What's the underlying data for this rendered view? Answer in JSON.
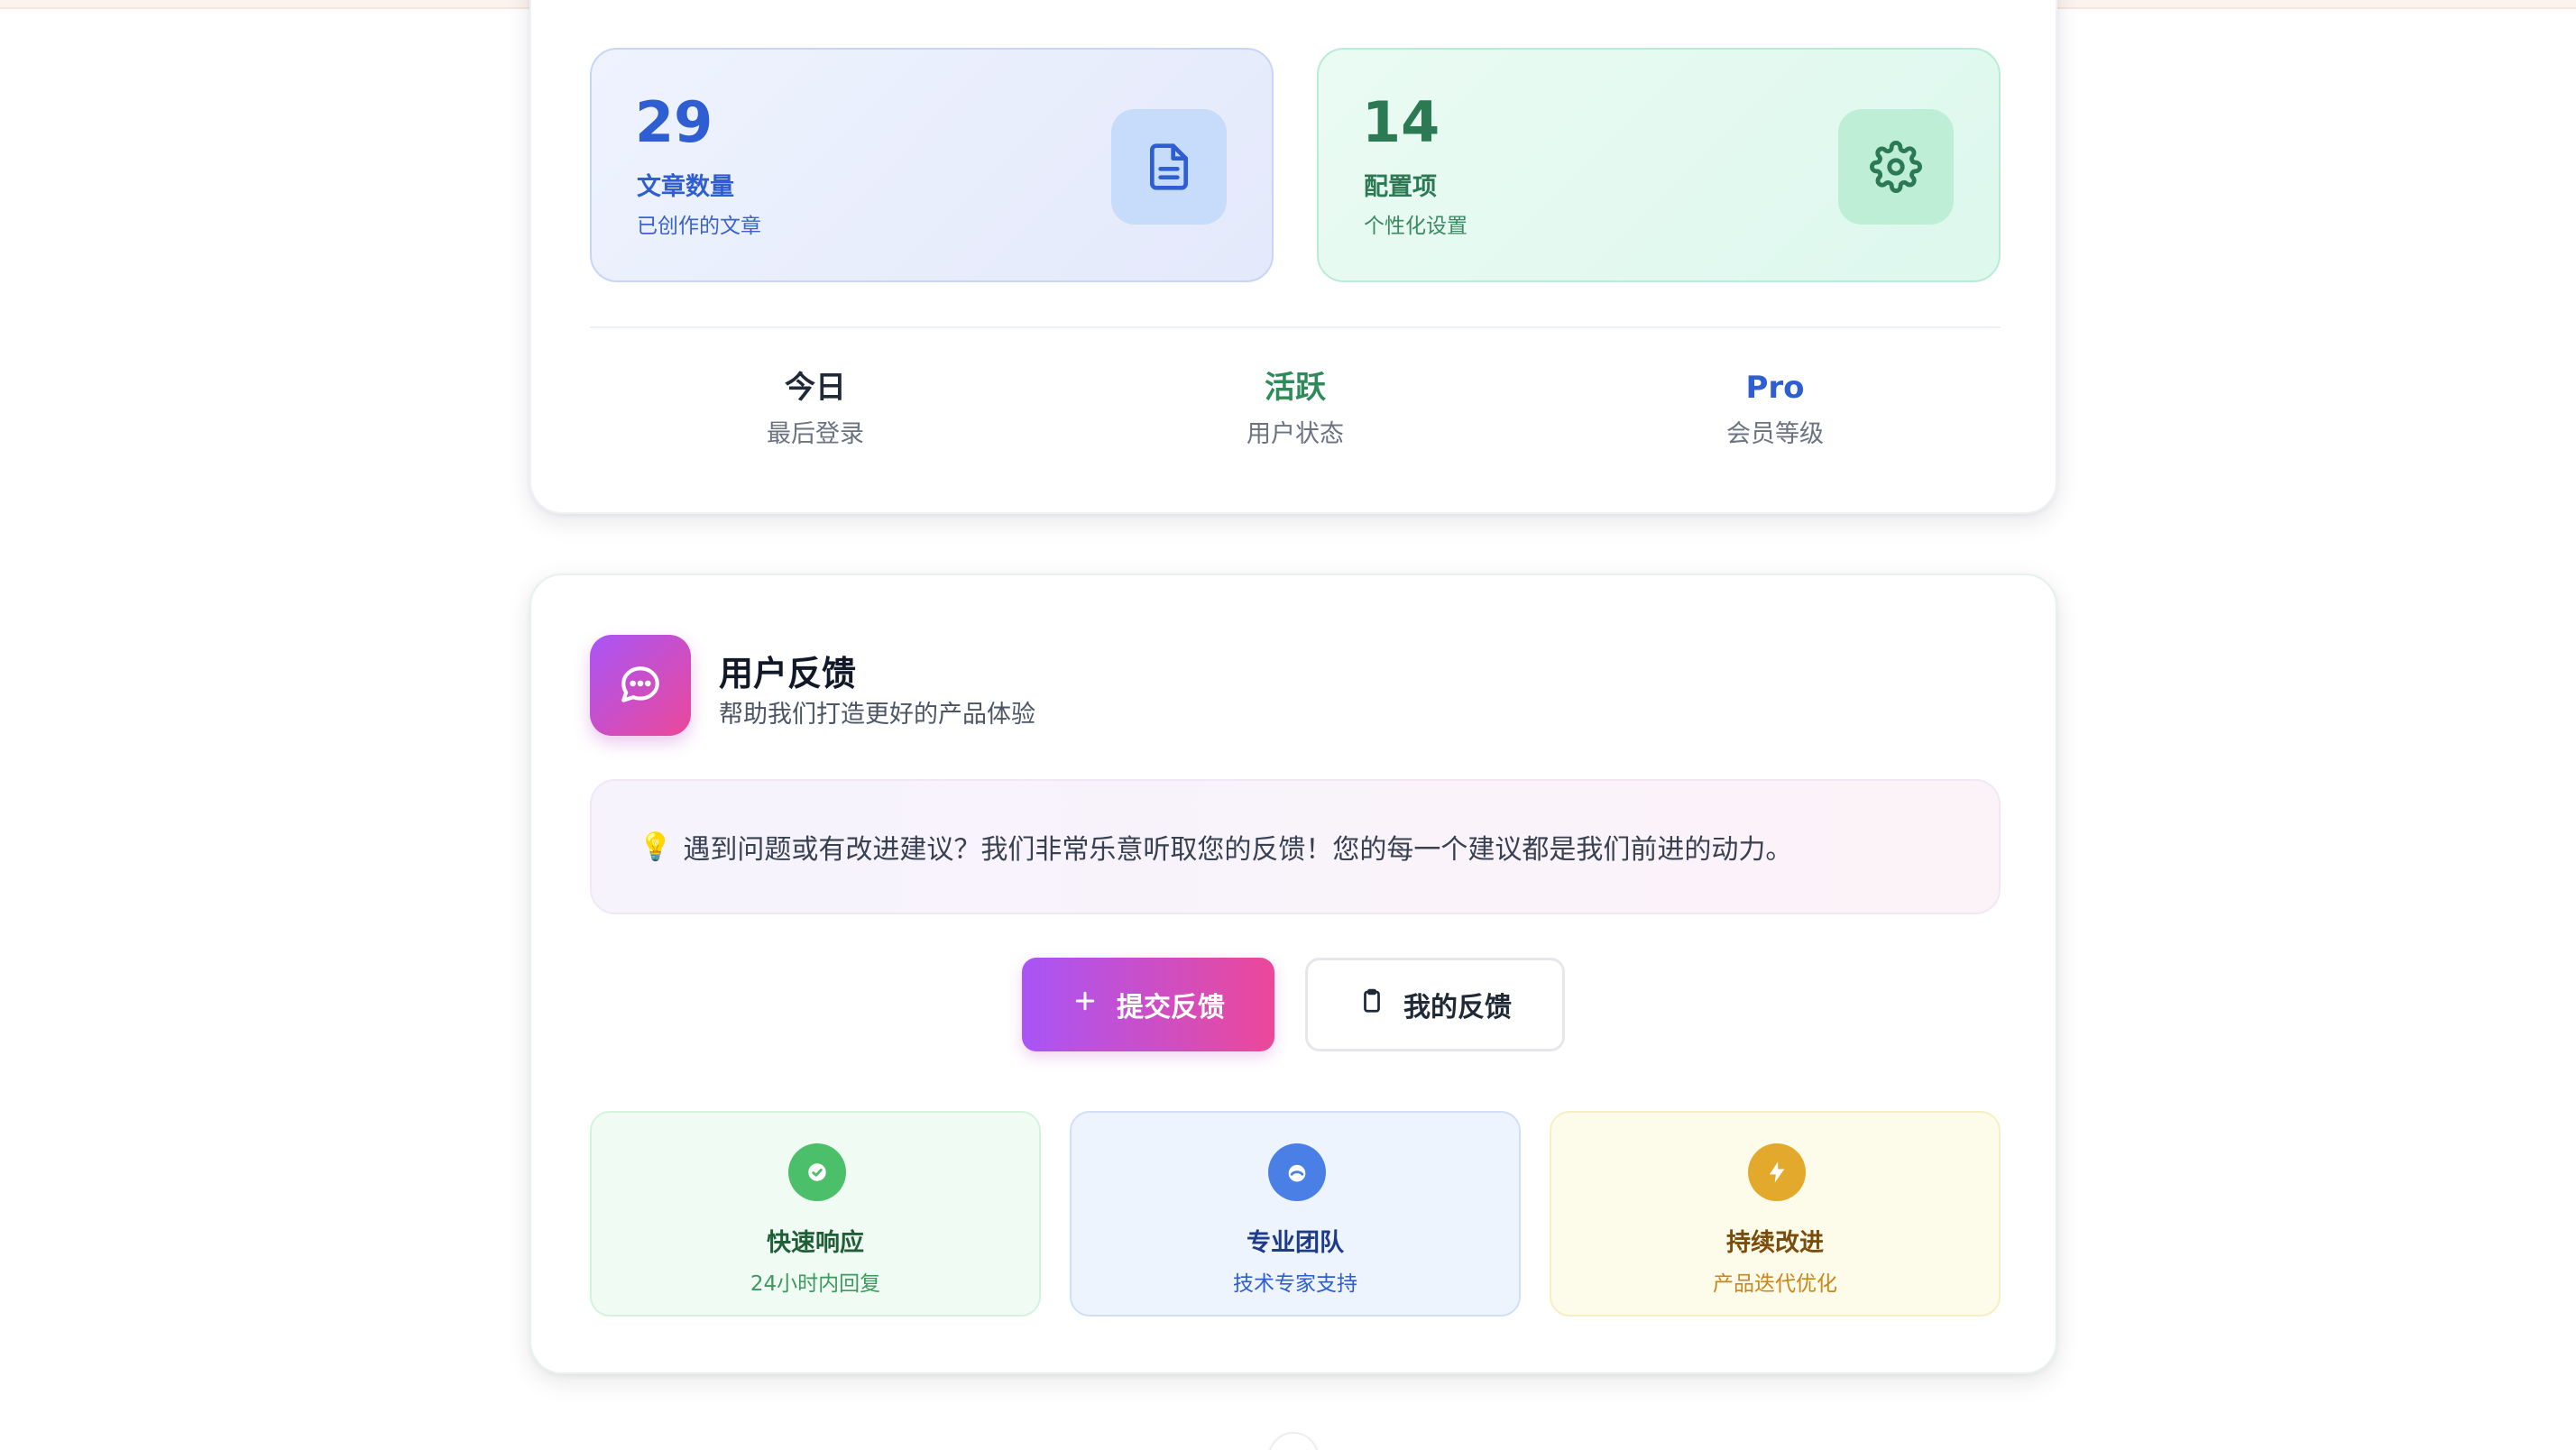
{
  "stats_card": {
    "articles": {
      "value": "29",
      "title": "文章数量",
      "subtitle": "已创作的文章",
      "icon": "document-icon",
      "color": "#2f5ed2"
    },
    "configs": {
      "value": "14",
      "title": "配置项",
      "subtitle": "个性化设置",
      "icon": "gear-icon",
      "color": "#2b7a54"
    },
    "meta": [
      {
        "value": "今日",
        "label": "最后登录",
        "color": "#1f2937"
      },
      {
        "value": "活跃",
        "label": "用户状态",
        "color": "#2f8a5a"
      },
      {
        "value": "Pro",
        "label": "会员等级",
        "color": "#2f5ed2"
      }
    ]
  },
  "feedback_card": {
    "icon": "chat-bubble-icon",
    "title": "用户反馈",
    "subtitle": "帮助我们打造更好的产品体验",
    "notice_emoji": "💡",
    "notice": "遇到问题或有改进建议？我们非常乐意听取您的反馈！您的每一个建议都是我们前进的动力。",
    "submit_button": {
      "label": "提交反馈",
      "icon": "plus-icon"
    },
    "my_feedback_button": {
      "label": "我的反馈",
      "icon": "clipboard-icon"
    },
    "features": [
      {
        "title": "快速响应",
        "subtitle": "24小时内回复",
        "icon": "check-circle-icon",
        "color": "#4cbf6b"
      },
      {
        "title": "专业团队",
        "subtitle": "技术专家支持",
        "icon": "team-icon",
        "color": "#4a7fe6"
      },
      {
        "title": "持续改进",
        "subtitle": "产品迭代优化",
        "icon": "lightning-icon",
        "color": "#e2a92c"
      }
    ]
  },
  "colors": {
    "accent_gradient_start": "#a855f7",
    "accent_gradient_end": "#ec4899"
  }
}
